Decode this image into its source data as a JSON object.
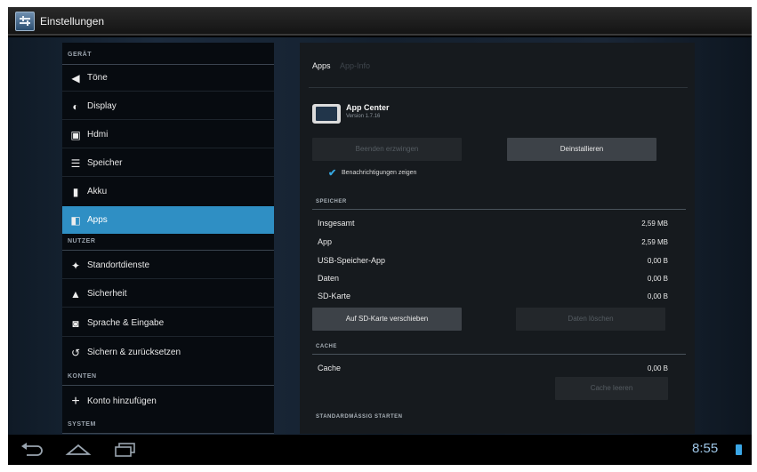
{
  "window": {
    "title": "Einstellungen"
  },
  "sidebar": {
    "sections": [
      {
        "header": "GERÄT"
      },
      {
        "header": "NUTZER"
      },
      {
        "header": "KONTEN"
      },
      {
        "header": "SYSTEM"
      }
    ],
    "items": [
      {
        "label": "Töne",
        "icon": "speaker-icon"
      },
      {
        "label": "Display",
        "icon": "brightness-icon"
      },
      {
        "label": "Hdmi",
        "icon": "monitor-icon"
      },
      {
        "label": "Speicher",
        "icon": "storage-icon"
      },
      {
        "label": "Akku",
        "icon": "battery-icon"
      },
      {
        "label": "Apps",
        "icon": "apps-icon",
        "active": true
      },
      {
        "label": "Standortdienste",
        "icon": "location-icon"
      },
      {
        "label": "Sicherheit",
        "icon": "lock-icon"
      },
      {
        "label": "Sprache & Eingabe",
        "icon": "keyboard-icon"
      },
      {
        "label": "Sichern & zurücksetzen",
        "icon": "restore-icon"
      },
      {
        "label": "Konto hinzufügen",
        "icon": "plus-icon"
      }
    ]
  },
  "detail": {
    "breadcrumb": {
      "current": "Apps",
      "sub": "App-Info"
    },
    "app": {
      "name": "App Center",
      "version": "Version 1.7.16"
    },
    "buttons": {
      "force_stop": "Beenden erzwingen",
      "uninstall": "Deinstallieren",
      "move_to_sd": "Auf SD-Karte verschieben",
      "clear_data": "Daten löschen",
      "clear_cache": "Cache leeren"
    },
    "notifications_label": "Benachrichtigungen zeigen",
    "notifications_checked": true,
    "storage_header": "SPEICHER",
    "storage_rows": [
      {
        "label": "Insgesamt",
        "value": "2,59 MB"
      },
      {
        "label": "App",
        "value": "2,59 MB"
      },
      {
        "label": "USB-Speicher-App",
        "value": "0,00 B"
      },
      {
        "label": "Daten",
        "value": "0,00 B"
      },
      {
        "label": "SD-Karte",
        "value": "0,00 B"
      }
    ],
    "cache_header": "CACHE",
    "cache_row": {
      "label": "Cache",
      "value": "0,00 B"
    },
    "launch_header": "STANDARDMÄSSIG STARTEN"
  },
  "navbar": {
    "time": "8:55"
  },
  "colors": {
    "accent": "#2f8fc4",
    "checkbox": "#35a7e1",
    "clock": "#9ec6e6"
  }
}
